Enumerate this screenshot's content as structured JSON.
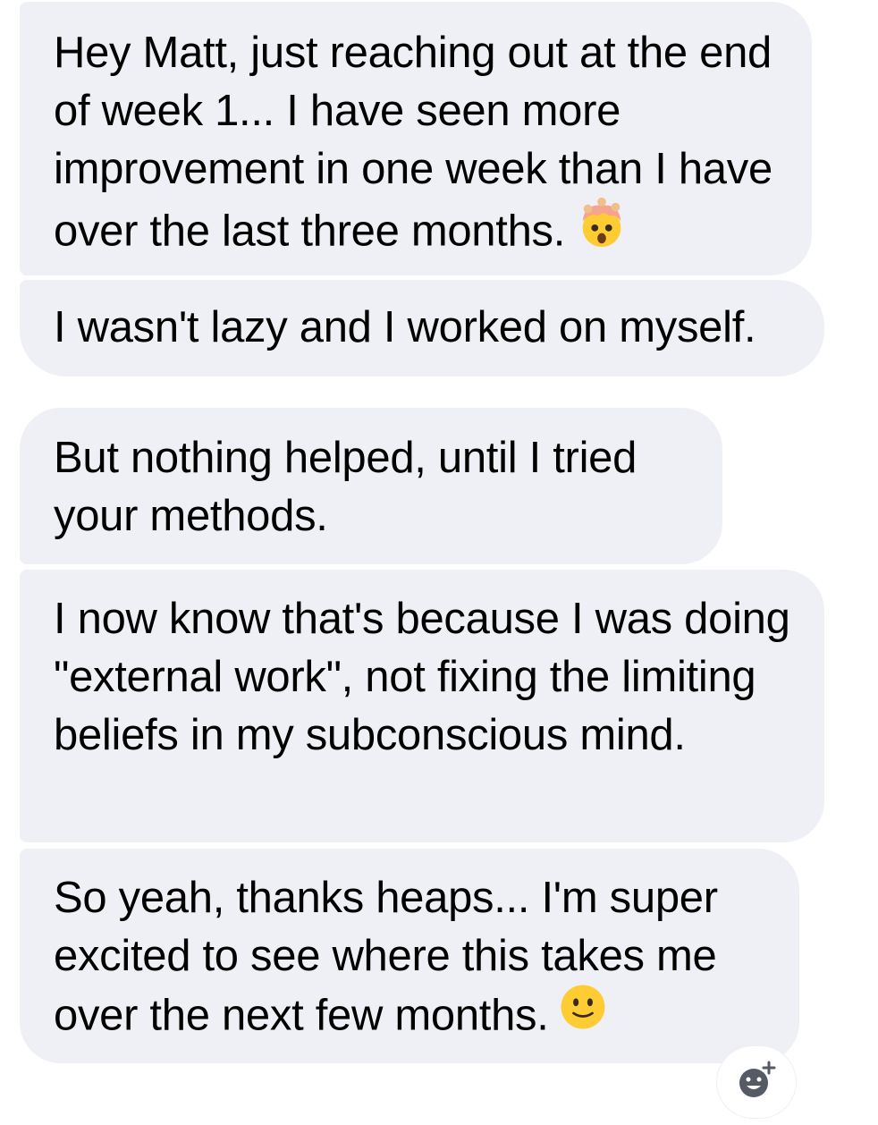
{
  "messages": [
    {
      "id": "m1",
      "text": "Hey Matt, just reaching out at the end of week 1... I have seen more improvement in one week than I have over the last three months.",
      "emoji": "mind-blown-icon"
    },
    {
      "id": "m2",
      "text": "I wasn't lazy and I worked on myself."
    },
    {
      "id": "m3",
      "text": "But nothing helped, until I tried your methods."
    },
    {
      "id": "m4",
      "text": "I now know that's because I was doing \"external work\", not fixing the limiting beliefs in my subconscious mind."
    },
    {
      "id": "m5",
      "text": "So yeah, thanks heaps... I'm super excited to see where this takes me over the next few months.",
      "emoji": "slight-smile-icon"
    }
  ],
  "colors": {
    "bubble_background": "#eff0f5",
    "text": "#000000",
    "emoji_yellow": "#ffcc33",
    "reaction_icon": "#555a64"
  },
  "reaction": {
    "icon": "add-reaction-icon"
  }
}
